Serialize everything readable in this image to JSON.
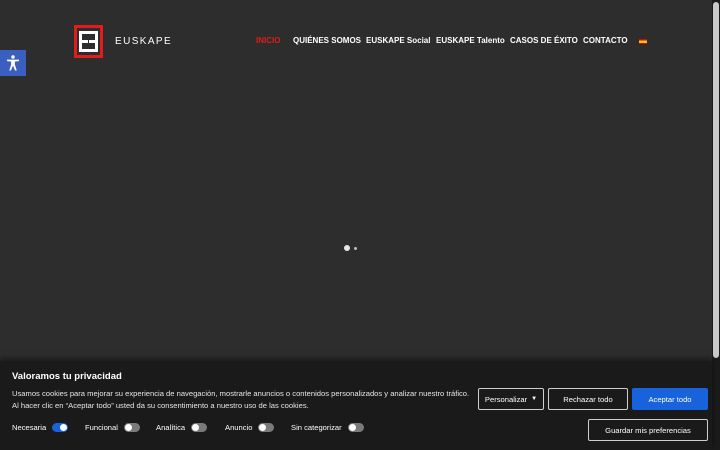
{
  "brand": {
    "name": "EUSKAPE",
    "accent_color": "#e21b1b"
  },
  "nav": {
    "items": [
      {
        "label": "INICIO",
        "active": true
      },
      {
        "label": "QUIÉNES SOMOS",
        "active": false
      },
      {
        "label": "EUSKAPE Social",
        "active": false
      },
      {
        "label": "EUSKAPE Talento",
        "active": false
      },
      {
        "label": "CASOS DE ÉXITO",
        "active": false
      },
      {
        "label": "CONTACTO",
        "active": false
      }
    ],
    "language_icon": "spain-flag-icon"
  },
  "accessibility_button": {
    "icon": "accessibility-person-icon",
    "color": "#3b5fc0"
  },
  "loader": {
    "icon": "loading-dots-icon"
  },
  "cookie_banner": {
    "title": "Valoramos tu privacidad",
    "description": "Usamos cookies para mejorar su experiencia de navegación, mostrarle anuncios o contenidos personalizados y analizar nuestro tráfico. Al hacer clic en “Aceptar todo” usted da su consentimiento a nuestro uso de las cookies.",
    "buttons": {
      "customize": "Personalizar",
      "reject": "Rechazar todo",
      "accept": "Aceptar todo",
      "save": "Guardar mis preferencias"
    },
    "primary_color": "#1863dc",
    "categories": [
      {
        "label": "Necesaria",
        "enabled": true
      },
      {
        "label": "Funcional",
        "enabled": false
      },
      {
        "label": "Analítica",
        "enabled": false
      },
      {
        "label": "Anuncio",
        "enabled": false
      },
      {
        "label": "Sin categorizar",
        "enabled": false
      }
    ]
  }
}
